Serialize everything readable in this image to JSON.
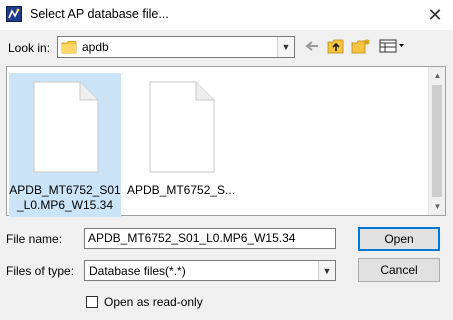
{
  "window": {
    "title": "Select AP database file...",
    "close_glyph": "✕"
  },
  "toolbar": {
    "lookin_label": "Look in:",
    "lookin_value": "apdb",
    "icons": [
      "back-arrow-icon",
      "up-folder-icon",
      "new-folder-icon",
      "view-menu-icon"
    ]
  },
  "files": [
    {
      "name": "APDB_MT6752_S01_L0.MP6_W15.34",
      "selected": true
    },
    {
      "name": "APDB_MT6752_S...",
      "selected": false
    }
  ],
  "form": {
    "filename_label": "File name:",
    "filename_value": "APDB_MT6752_S01_L0.MP6_W15.34",
    "filetype_label": "Files of type:",
    "filetype_value": "Database files(*.*)",
    "open_label": "Open",
    "cancel_label": "Cancel",
    "readonly_label": "Open as read-only",
    "readonly_checked": false
  },
  "colors": {
    "selection": "#cce4f7",
    "default_button_border": "#0078d7"
  }
}
